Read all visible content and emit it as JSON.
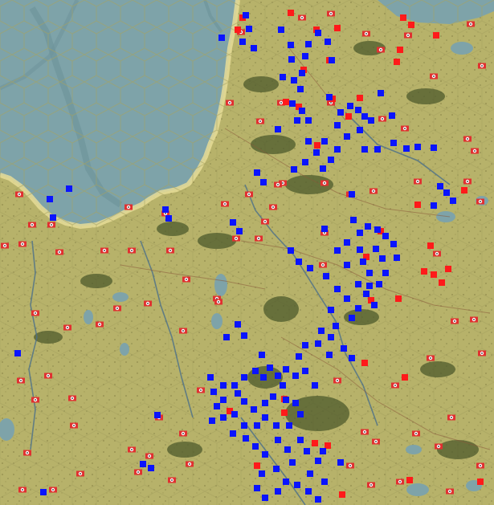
{
  "map": {
    "terrain_colors": {
      "water": "#7ea3a9",
      "water_dark": "#6d939a",
      "land": "#b7b26a",
      "land_light": "#c6c17a",
      "forest": "#4d5a2c",
      "shoreline": "#e6dc96",
      "river": "#4b6f8a",
      "road": "#8a5a3a",
      "hex_line": "#a6a363"
    }
  },
  "factions": {
    "blue": {
      "color": "#0a14ff",
      "icon": "unit-marker-square"
    },
    "red": {
      "color": "#ff1a1a",
      "icon": "unit-marker-square"
    },
    "neutral": {
      "color": "#ffffff",
      "ring": "#e03030",
      "icon": "town-marker-icon"
    }
  }
}
